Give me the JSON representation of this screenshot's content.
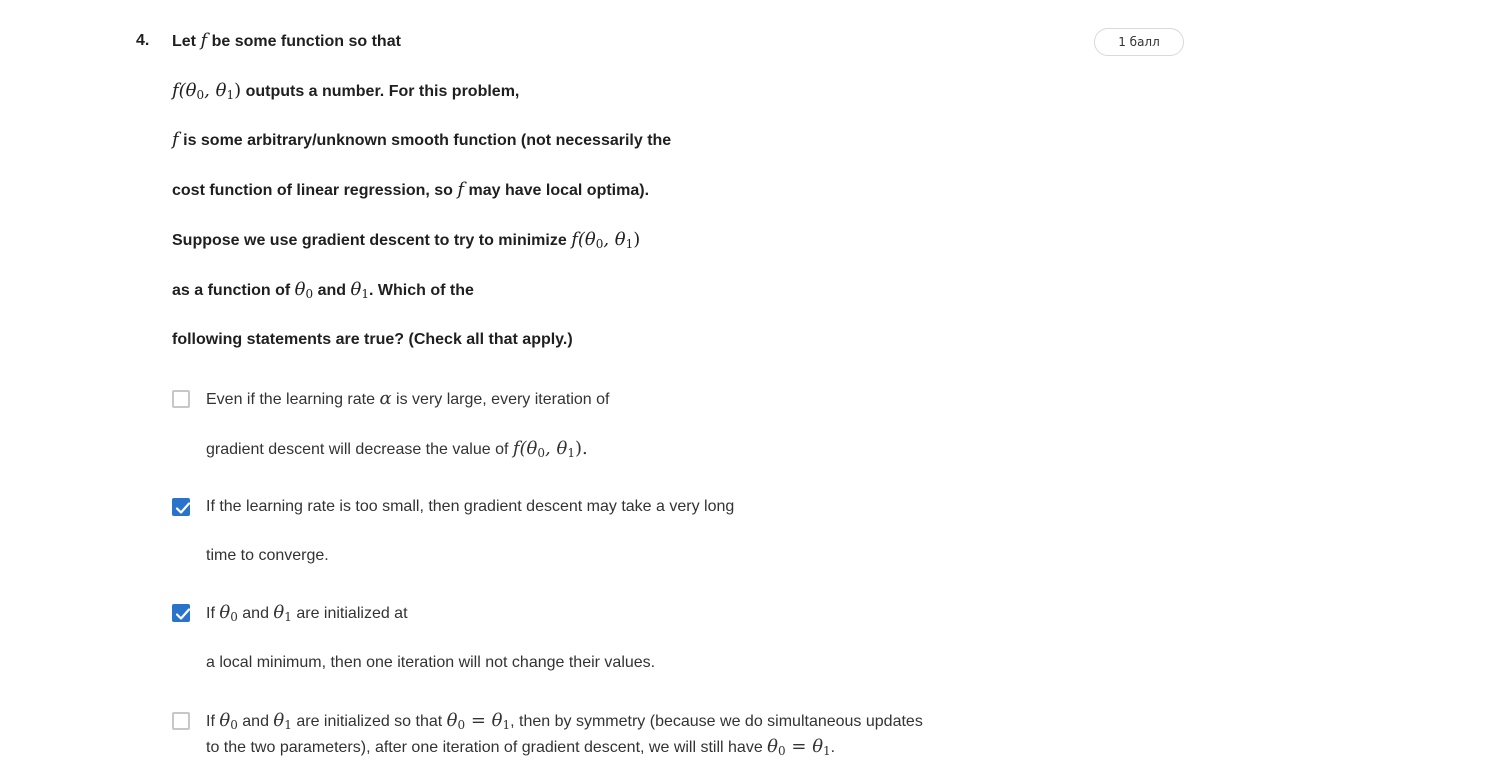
{
  "question": {
    "number": "4.",
    "points": "1 балл",
    "prompt": {
      "l1_a": "Let ",
      "l1_f": "f",
      "l1_b": " be some function so that",
      "l2_math": "f(θ",
      "l2_s0": "0",
      "l2_comma": ", θ",
      "l2_s1": "1",
      "l2_close": ")",
      "l2_text": " outputs a number. For this problem,",
      "l3_f": "f",
      "l3_text": " is some arbitrary/unknown smooth function (not necessarily the",
      "l4_a": "cost function of linear regression, so ",
      "l4_f": "f",
      "l4_b": " may have local optima).",
      "l5_text": "Suppose we use gradient descent to try to minimize ",
      "l5_math": "f(θ",
      "l5_s0": "0",
      "l5_comma": ", θ",
      "l5_s1": "1",
      "l5_close": ")",
      "l6_a": "as a function of ",
      "l6_t0": "θ",
      "l6_s0": "0",
      "l6_b": " and ",
      "l6_t1": "θ",
      "l6_s1": "1",
      "l6_c": ". Which of the",
      "l7_text": "following statements are true? (Check all that apply.)"
    }
  },
  "options": [
    {
      "checked": false,
      "line1_a": "Even if the learning rate ",
      "line1_alpha": "α",
      "line1_b": " is very large, every iteration of",
      "line2_a": "gradient descent will decrease the value of ",
      "line2_math": "f(θ",
      "line2_s0": "0",
      "line2_comma": ", θ",
      "line2_s1": "1",
      "line2_close": ").",
      "line2_end": ""
    },
    {
      "checked": true,
      "line1": "If the learning rate is too small, then gradient descent may take a very long",
      "line2": "time to converge."
    },
    {
      "checked": true,
      "line1_a": "If ",
      "line1_t0": "θ",
      "line1_s0": "0",
      "line1_b": " and ",
      "line1_t1": "θ",
      "line1_s1": "1",
      "line1_c": " are initialized at",
      "line2": "a local minimum, then one iteration will not change their values."
    },
    {
      "checked": false,
      "line1_a": "If ",
      "line1_t0": "θ",
      "line1_s0": "0",
      "line1_b": " and ",
      "line1_t1": "θ",
      "line1_s1": "1",
      "line1_c": " are initialized so that ",
      "line1_eq_t0": "θ",
      "line1_eq_s0": "0",
      "line1_eq": " = ",
      "line1_eq_t1": "θ",
      "line1_eq_s1": "1",
      "line1_d": ", then by symmetry (because we do simultaneous updates",
      "line2_a": "to the two parameters), after one iteration of gradient descent, we will still have ",
      "line2_t0": "θ",
      "line2_s0": "0",
      "line2_eq": " = ",
      "line2_t1": "θ",
      "line2_s1": "1",
      "line2_end": "."
    }
  ],
  "colors": {
    "checkbox_checked": "#2a73cc",
    "checkbox_border": "#c7c7c7",
    "text_prompt": "#1f1f1f",
    "text_option": "#333333"
  }
}
